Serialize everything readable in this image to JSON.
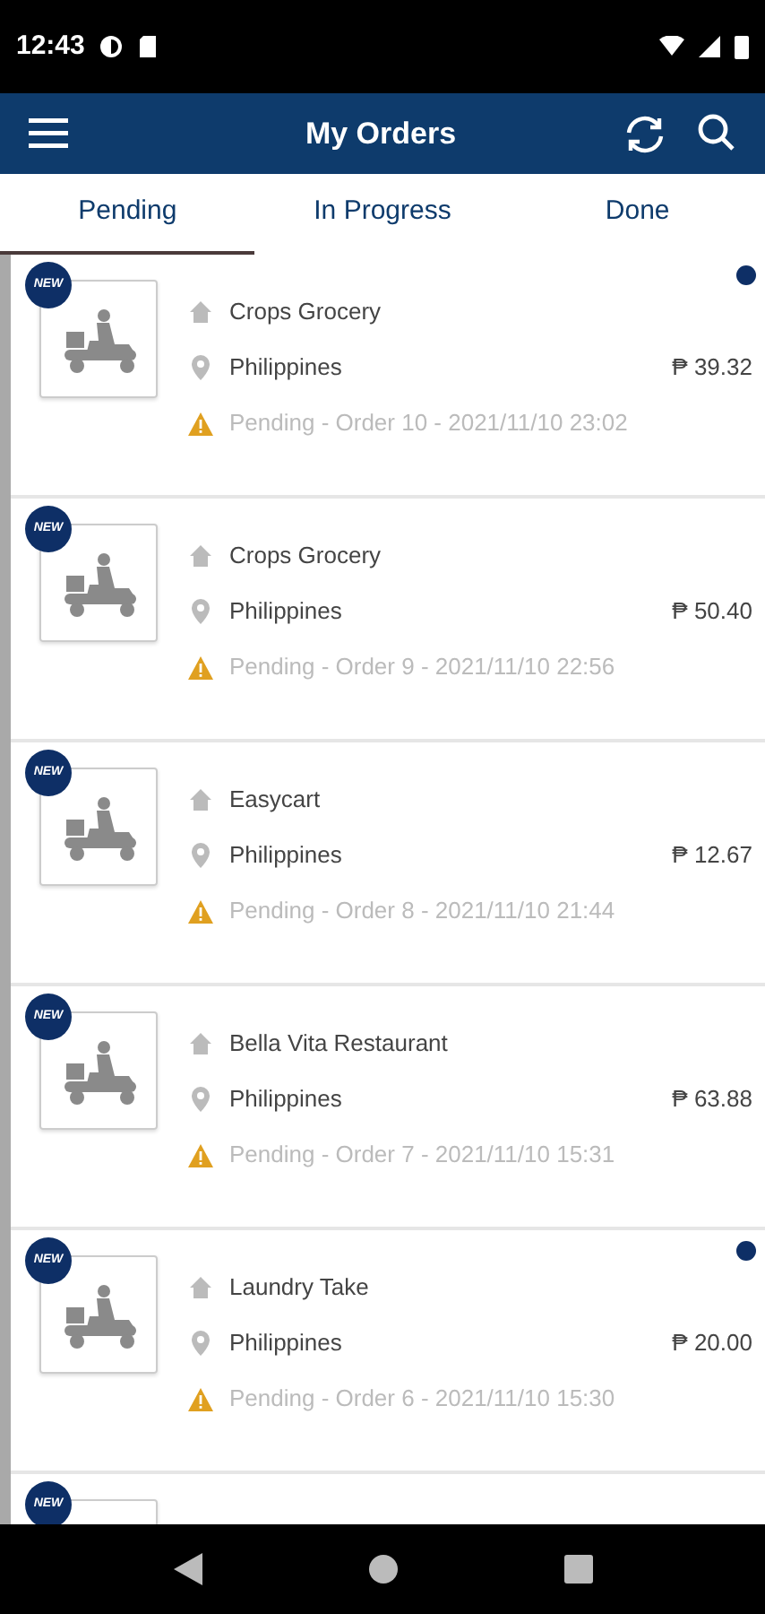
{
  "status_bar": {
    "time": "12:43"
  },
  "header": {
    "title": "My Orders"
  },
  "tabs": [
    {
      "label": "Pending",
      "selected": true
    },
    {
      "label": "In Progress",
      "selected": false
    },
    {
      "label": "Done",
      "selected": false
    }
  ],
  "orders": [
    {
      "badge": "NEW",
      "store": "Crops Grocery",
      "location": "Philippines",
      "price": "₱ 39.32",
      "status": "Pending - Order 10 - 2021/11/10 23:02",
      "unread": true
    },
    {
      "badge": "NEW",
      "store": "Crops Grocery",
      "location": "Philippines",
      "price": "₱ 50.40",
      "status": "Pending - Order 9 - 2021/11/10 22:56",
      "unread": false
    },
    {
      "badge": "NEW",
      "store": "Easycart",
      "location": "Philippines",
      "price": "₱ 12.67",
      "status": "Pending - Order 8 - 2021/11/10 21:44",
      "unread": false
    },
    {
      "badge": "NEW",
      "store": "Bella Vita Restaurant",
      "location": "Philippines",
      "price": "₱ 63.88",
      "status": "Pending - Order 7 - 2021/11/10 15:31",
      "unread": false
    },
    {
      "badge": "NEW",
      "store": "Laundry Take",
      "location": "Philippines",
      "price": "₱ 20.00",
      "status": "Pending - Order 6 - 2021/11/10 15:30",
      "unread": true
    },
    {
      "badge": "NEW",
      "unread": false
    }
  ]
}
